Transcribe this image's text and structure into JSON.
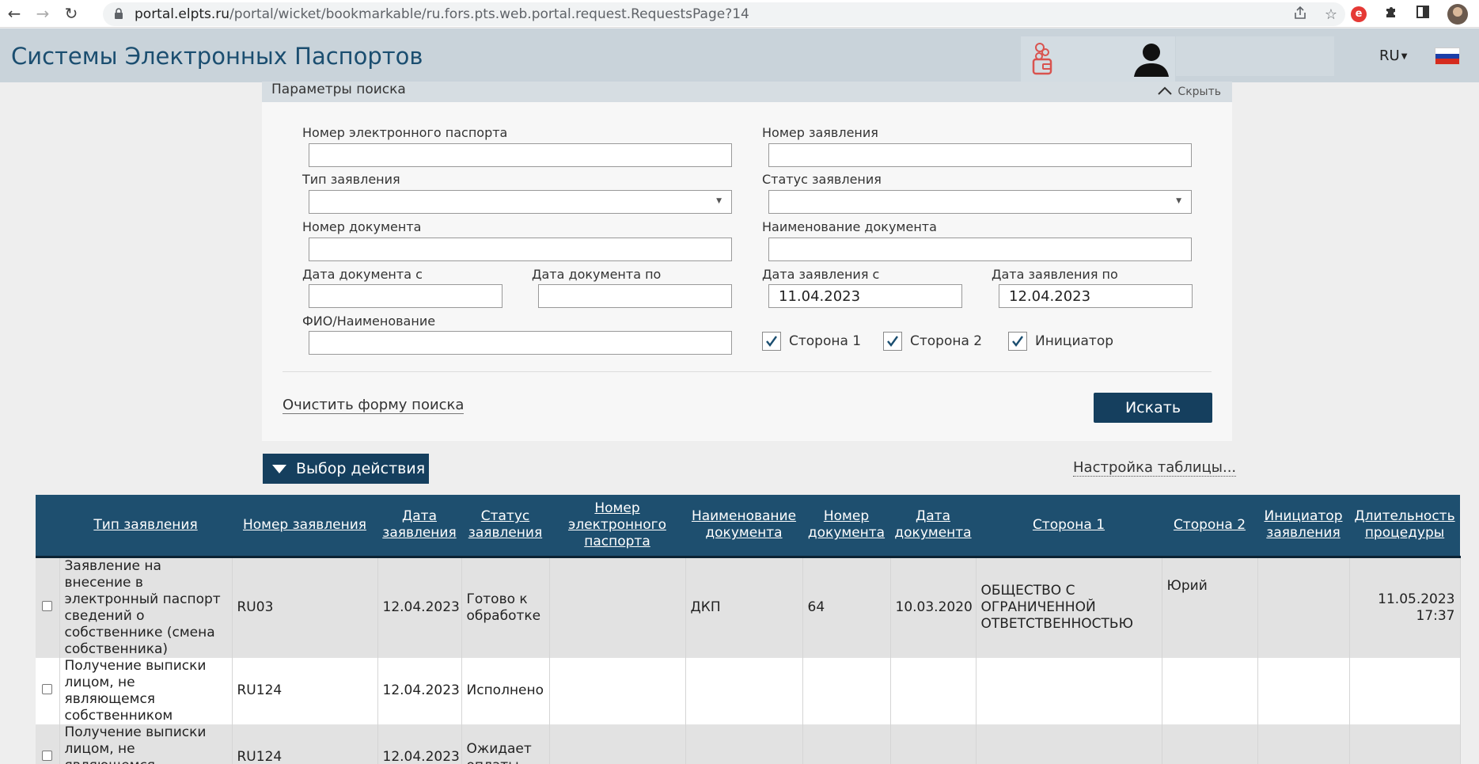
{
  "browser": {
    "url_host": "portal.elpts.ru",
    "url_path": "/portal/wicket/bookmarkable/ru.fors.pts.web.portal.request.RequestsPage?14"
  },
  "header": {
    "app_title": "Системы Электронных Паспортов",
    "lang": "RU"
  },
  "search": {
    "title": "Параметры поиска",
    "hide_label": "Скрыть",
    "fields": {
      "passport_number_label": "Номер электронного паспорта",
      "passport_number_value": "",
      "request_number_label": "Номер заявления",
      "request_number_value": "",
      "request_type_label": "Тип заявления",
      "request_type_value": "",
      "request_status_label": "Статус заявления",
      "request_status_value": "",
      "doc_number_label": "Номер документа",
      "doc_number_value": "",
      "doc_name_label": "Наименование документа",
      "doc_name_value": "",
      "doc_date_from_label": "Дата документа с",
      "doc_date_from_value": "",
      "doc_date_to_label": "Дата документа по",
      "doc_date_to_value": "",
      "req_date_from_label": "Дата заявления с",
      "req_date_from_value": "11.04.2023",
      "req_date_to_label": "Дата заявления по",
      "req_date_to_value": "12.04.2023",
      "fio_label": "ФИО/Наименование",
      "fio_value": ""
    },
    "checks": {
      "side1": "Сторона 1",
      "side2": "Сторона 2",
      "initiator": "Инициатор"
    },
    "clear_label": "Очистить форму поиска",
    "search_label": "Искать"
  },
  "actions": {
    "action_label": "Выбор действия",
    "table_settings_label": "Настройка таблицы..."
  },
  "table": {
    "headers": {
      "type": "Тип заявления",
      "number": "Номер заявления",
      "date": "Дата заявления",
      "status": "Статус заявления",
      "passport": "Номер электронного паспорта",
      "doc_name": "Наименование документа",
      "doc_number": "Номер документа",
      "doc_date": "Дата документа",
      "side1": "Сторона 1",
      "side2": "Сторона 2",
      "initiator": "Инициатор заявления",
      "duration": "Длительность процедуры"
    },
    "rows": [
      {
        "type": "Заявление на внесение в электронный паспорт сведений о собственнике (смена собственника)",
        "number": "RU03",
        "date": "12.04.2023",
        "status": "Готово к обработке",
        "passport": "",
        "doc_name": "ДКП",
        "doc_number": "64",
        "doc_date": "10.03.2020",
        "side1": "ОБЩЕСТВО С ОГРАНИЧЕННОЙ ОТВЕТСТВЕННОСТЬЮ",
        "side2": "Юрий",
        "initiator": "",
        "duration": "11.05.2023 17:37"
      },
      {
        "type": "Получение выписки лицом, не являющемся собственником",
        "number": "RU124",
        "date": "12.04.2023",
        "status": "Исполнено",
        "passport": "",
        "doc_name": "",
        "doc_number": "",
        "doc_date": "",
        "side1": "",
        "side2": "",
        "initiator": "",
        "duration": ""
      },
      {
        "type": "Получение выписки лицом, не являющемся собственником",
        "number": "RU124",
        "date": "12.04.2023",
        "status": "Ожидает оплаты",
        "passport": "",
        "doc_name": "",
        "doc_number": "",
        "doc_date": "",
        "side1": "",
        "side2": "",
        "initiator": "",
        "duration": ""
      }
    ]
  },
  "colors": {
    "header_bg": "#c9d3da",
    "title_color": "#1b4e70",
    "primary_button": "#153f5e",
    "table_header": "#1e4f6f",
    "check_color": "#1b4e70"
  }
}
